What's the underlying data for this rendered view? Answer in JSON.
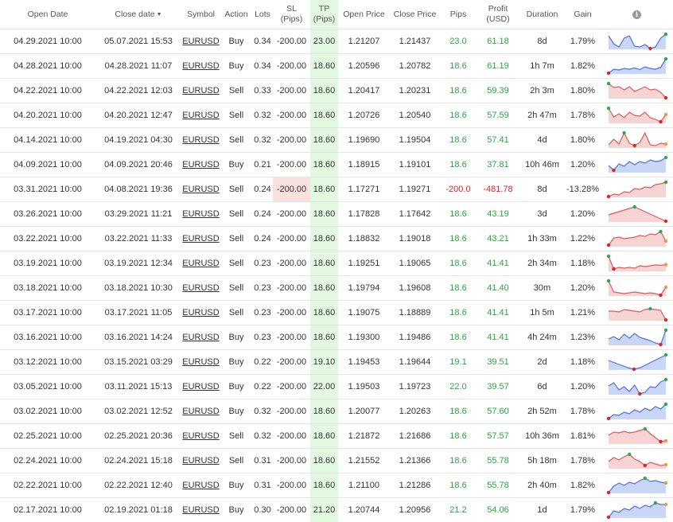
{
  "headers": {
    "open_date": "Open Date",
    "close_date": "Close date",
    "close_date_sort": "▼",
    "symbol": "Symbol",
    "action": "Action",
    "lots": "Lots",
    "sl_line1": "SL",
    "sl_line2": "(Pips)",
    "tp_line1": "TP",
    "tp_line2": "(Pips)",
    "open_price": "Open Price",
    "close_price": "Close Price",
    "pips": "Pips",
    "profit_line1": "Profit",
    "profit_line2": "(USD)",
    "duration": "Duration",
    "gain": "Gain",
    "info_icon": "info-icon"
  },
  "colors": {
    "positive": "#27a744",
    "negative": "#e02424",
    "tp_cell_bg": "#e3f8e0",
    "sl_cell_bg": "#fbe0e0",
    "buy_line": "#4f70dc",
    "buy_fill": "#c9d6f6",
    "sell_line": "#dc5a5a",
    "sell_fill": "#f6d4d4",
    "max_marker": "#2ea84a",
    "min_marker": "#e02424",
    "end_marker": "#f0964a"
  },
  "trades": [
    {
      "open_date": "04.29.2021 10:00",
      "close_date": "05.07.2021 15:53",
      "symbol": "EURUSD",
      "action": "Buy",
      "lots": "0.34",
      "sl": "-200.00",
      "tp": "23.00",
      "open_price": "1.21207",
      "close_price": "1.21437",
      "pips": "23.0",
      "profit": "61.18",
      "duration": "8d",
      "gain": "1.79%",
      "trend": [
        0.85,
        0.35,
        0.15,
        0.7,
        0.85,
        0.2,
        0.15,
        0.3,
        0.05,
        0.15,
        0.7,
        0.95
      ]
    },
    {
      "open_date": "04.28.2021 10:00",
      "close_date": "04.28.2021 11:07",
      "symbol": "EURUSD",
      "action": "Buy",
      "lots": "0.34",
      "sl": "-200.00",
      "tp": "18.60",
      "open_price": "1.20596",
      "close_price": "1.20782",
      "pips": "18.6",
      "profit": "61.19",
      "duration": "1h 7m",
      "gain": "1.82%",
      "trend": [
        0.05,
        0.3,
        0.25,
        0.35,
        0.3,
        0.38,
        0.28,
        0.45,
        0.35,
        0.3,
        0.42,
        0.95
      ]
    },
    {
      "open_date": "04.22.2021 10:00",
      "close_date": "04.22.2021 12:03",
      "symbol": "EURUSD",
      "action": "Sell",
      "lots": "0.33",
      "sl": "-200.00",
      "tp": "18.60",
      "open_price": "1.20417",
      "close_price": "1.20231",
      "pips": "18.6",
      "profit": "59.39",
      "duration": "2h 3m",
      "gain": "1.80%",
      "trend": [
        0.95,
        0.7,
        0.75,
        0.55,
        0.75,
        0.45,
        0.6,
        0.75,
        0.55,
        0.6,
        0.4,
        0.05
      ]
    },
    {
      "open_date": "04.20.2021 10:00",
      "close_date": "04.20.2021 12:47",
      "symbol": "EURUSD",
      "action": "Sell",
      "lots": "0.32",
      "sl": "-200.00",
      "tp": "18.60",
      "open_price": "1.20726",
      "close_price": "1.20540",
      "pips": "18.6",
      "profit": "57.59",
      "duration": "2h 47m",
      "gain": "1.78%",
      "trend": [
        0.95,
        0.4,
        0.6,
        0.35,
        0.7,
        0.5,
        0.45,
        0.7,
        0.35,
        0.25,
        0.1,
        0.55
      ]
    },
    {
      "open_date": "04.14.2021 10:00",
      "close_date": "04.19.2021 04:30",
      "symbol": "EURUSD",
      "action": "Sell",
      "lots": "0.32",
      "sl": "-200.00",
      "tp": "18.60",
      "open_price": "1.19690",
      "close_price": "1.19504",
      "pips": "18.6",
      "profit": "57.41",
      "duration": "4d",
      "gain": "1.80%",
      "trend": [
        0.2,
        0.55,
        0.25,
        0.95,
        0.3,
        0.15,
        0.35,
        0.95,
        0.2,
        0.15,
        0.3,
        0.25
      ]
    },
    {
      "open_date": "04.09.2021 10:00",
      "close_date": "04.09.2021 20:46",
      "symbol": "EURUSD",
      "action": "Buy",
      "lots": "0.21",
      "sl": "-200.00",
      "tp": "18.60",
      "open_price": "1.18915",
      "close_price": "1.19101",
      "pips": "18.6",
      "profit": "37.81",
      "duration": "10h 46m",
      "gain": "1.20%",
      "trend": [
        0.45,
        0.15,
        0.55,
        0.4,
        0.7,
        0.5,
        0.7,
        0.6,
        0.8,
        0.7,
        0.75,
        0.95
      ]
    },
    {
      "open_date": "03.31.2021 10:00",
      "close_date": "04.08.2021 19:36",
      "symbol": "EURUSD",
      "action": "Sell",
      "lots": "0.24",
      "sl": "-200.00",
      "tp": "18.60",
      "open_price": "1.17271",
      "close_price": "1.19271",
      "pips": "-200.0",
      "profit": "-481.78",
      "duration": "8d",
      "gain": "-13.28%",
      "sl_hit": true,
      "trend": [
        0.05,
        0.2,
        0.15,
        0.35,
        0.3,
        0.55,
        0.5,
        0.65,
        0.6,
        0.8,
        0.85,
        0.95
      ]
    },
    {
      "open_date": "03.26.2021 10:00",
      "close_date": "03.29.2021 11:21",
      "symbol": "EURUSD",
      "action": "Sell",
      "lots": "0.24",
      "sl": "-200.00",
      "tp": "18.60",
      "open_price": "1.17828",
      "close_price": "1.17642",
      "pips": "18.6",
      "profit": "43.19",
      "duration": "3d",
      "gain": "1.20%",
      "trend": [
        0.45,
        0.55,
        0.65,
        0.75,
        0.85,
        0.95,
        0.8,
        0.65,
        0.5,
        0.35,
        0.2,
        0.05
      ]
    },
    {
      "open_date": "03.22.2021 10:00",
      "close_date": "03.22.2021 11:33",
      "symbol": "EURUSD",
      "action": "Sell",
      "lots": "0.24",
      "sl": "-200.00",
      "tp": "18.60",
      "open_price": "1.18832",
      "close_price": "1.19018",
      "pips": "18.6",
      "profit": "43.21",
      "duration": "1h 33m",
      "gain": "1.22%",
      "trend": [
        0.1,
        0.55,
        0.6,
        0.5,
        0.55,
        0.6,
        0.7,
        0.65,
        0.8,
        0.75,
        0.95,
        0.35
      ]
    },
    {
      "open_date": "03.19.2021 10:00",
      "close_date": "03.19.2021 12:34",
      "symbol": "EURUSD",
      "action": "Sell",
      "lots": "0.23",
      "sl": "-200.00",
      "tp": "18.60",
      "open_price": "1.19251",
      "close_price": "1.19065",
      "pips": "18.6",
      "profit": "41.41",
      "duration": "2h 34m",
      "gain": "1.18%",
      "trend": [
        0.95,
        0.15,
        0.25,
        0.2,
        0.25,
        0.2,
        0.35,
        0.3,
        0.35,
        0.4,
        0.38,
        0.42
      ]
    },
    {
      "open_date": "03.18.2021 10:00",
      "close_date": "03.18.2021 10:30",
      "symbol": "EURUSD",
      "action": "Sell",
      "lots": "0.23",
      "sl": "-200.00",
      "tp": "18.60",
      "open_price": "1.19794",
      "close_price": "1.19608",
      "pips": "18.6",
      "profit": "41.40",
      "duration": "30m",
      "gain": "1.20%",
      "trend": [
        0.95,
        0.25,
        0.2,
        0.15,
        0.2,
        0.25,
        0.2,
        0.15,
        0.2,
        0.15,
        0.05,
        0.55
      ]
    },
    {
      "open_date": "03.17.2021 10:00",
      "close_date": "03.17.2021 11:05",
      "symbol": "EURUSD",
      "action": "Sell",
      "lots": "0.23",
      "sl": "-200.00",
      "tp": "18.60",
      "open_price": "1.19075",
      "close_price": "1.18889",
      "pips": "18.6",
      "profit": "41.41",
      "duration": "1h 5m",
      "gain": "1.21%",
      "trend": [
        0.6,
        0.6,
        0.55,
        0.7,
        0.65,
        0.6,
        0.55,
        0.7,
        0.75,
        0.7,
        0.65,
        0.05
      ]
    },
    {
      "open_date": "03.16.2021 10:00",
      "close_date": "03.16.2021 14:24",
      "symbol": "EURUSD",
      "action": "Buy",
      "lots": "0.23",
      "sl": "-200.00",
      "tp": "18.60",
      "open_price": "1.19300",
      "close_price": "1.19486",
      "pips": "18.6",
      "profit": "41.41",
      "duration": "4h 24m",
      "gain": "1.23%",
      "trend": [
        0.4,
        0.55,
        0.35,
        0.7,
        0.45,
        0.75,
        0.5,
        0.4,
        0.3,
        0.15,
        0.05,
        0.95
      ]
    },
    {
      "open_date": "03.12.2021 10:00",
      "close_date": "03.15.2021 03:29",
      "symbol": "EURUSD",
      "action": "Buy",
      "lots": "0.22",
      "sl": "-200.00",
      "tp": "19.10",
      "open_price": "1.19453",
      "close_price": "1.19644",
      "pips": "19.1",
      "profit": "39.51",
      "duration": "2d",
      "gain": "1.18%",
      "trend": [
        0.6,
        0.45,
        0.3,
        0.15,
        0.05,
        0.15,
        0.35,
        0.55,
        0.75,
        0.95
      ]
    },
    {
      "open_date": "03.05.2021 10:00",
      "close_date": "03.11.2021 15:13",
      "symbol": "EURUSD",
      "action": "Buy",
      "lots": "0.22",
      "sl": "-200.00",
      "tp": "22.00",
      "open_price": "1.19503",
      "close_price": "1.19723",
      "pips": "22.0",
      "profit": "39.57",
      "duration": "6d",
      "gain": "1.20%",
      "trend": [
        0.55,
        0.75,
        0.3,
        0.5,
        0.2,
        0.6,
        0.05,
        0.15,
        0.5,
        0.45,
        0.8,
        0.95
      ]
    },
    {
      "open_date": "03.02.2021 10:00",
      "close_date": "03.02.2021 12:52",
      "symbol": "EURUSD",
      "action": "Buy",
      "lots": "0.32",
      "sl": "-200.00",
      "tp": "18.60",
      "open_price": "1.20077",
      "close_price": "1.20263",
      "pips": "18.6",
      "profit": "57.60",
      "duration": "2h 52m",
      "gain": "1.78%",
      "trend": [
        0.05,
        0.3,
        0.25,
        0.45,
        0.35,
        0.6,
        0.45,
        0.7,
        0.55,
        0.8,
        0.65,
        0.95
      ]
    },
    {
      "open_date": "02.25.2021 10:00",
      "close_date": "02.25.2021 20:36",
      "symbol": "EURUSD",
      "action": "Sell",
      "lots": "0.32",
      "sl": "-200.00",
      "tp": "18.60",
      "open_price": "1.21872",
      "close_price": "1.21686",
      "pips": "18.6",
      "profit": "57.57",
      "duration": "10h 36m",
      "gain": "1.81%",
      "trend": [
        0.55,
        0.75,
        0.7,
        0.8,
        0.7,
        0.75,
        0.85,
        0.95,
        0.65,
        0.4,
        0.15,
        0.2
      ]
    },
    {
      "open_date": "02.24.2021 10:00",
      "close_date": "02.24.2021 15:18",
      "symbol": "EURUSD",
      "action": "Sell",
      "lots": "0.31",
      "sl": "-200.00",
      "tp": "18.60",
      "open_price": "1.21552",
      "close_price": "1.21366",
      "pips": "18.6",
      "profit": "55.78",
      "duration": "5h 18m",
      "gain": "1.78%",
      "trend": [
        0.45,
        0.7,
        0.55,
        0.75,
        0.9,
        0.6,
        0.45,
        0.2,
        0.4,
        0.3,
        0.2,
        0.25
      ]
    },
    {
      "open_date": "02.22.2021 10:00",
      "close_date": "02.22.2021 12:40",
      "symbol": "EURUSD",
      "action": "Buy",
      "lots": "0.31",
      "sl": "-200.00",
      "tp": "18.60",
      "open_price": "1.21100",
      "close_price": "1.21286",
      "pips": "18.6",
      "profit": "55.78",
      "duration": "2h 40m",
      "gain": "1.82%",
      "trend": [
        0.05,
        0.45,
        0.65,
        0.5,
        0.7,
        0.6,
        0.8,
        0.95,
        0.75,
        0.8,
        0.7,
        0.65
      ]
    },
    {
      "open_date": "02.17.2021 10:00",
      "close_date": "02.19.2021 01:18",
      "symbol": "EURUSD",
      "action": "Buy",
      "lots": "0.30",
      "sl": "-200.00",
      "tp": "21.20",
      "open_price": "1.20744",
      "close_price": "1.20956",
      "pips": "21.2",
      "profit": "54.06",
      "duration": "1d",
      "gain": "1.79%",
      "trend": [
        0.05,
        0.45,
        0.35,
        0.6,
        0.5,
        0.75,
        0.6,
        0.8,
        0.7,
        0.95,
        0.85,
        0.85
      ]
    }
  ]
}
